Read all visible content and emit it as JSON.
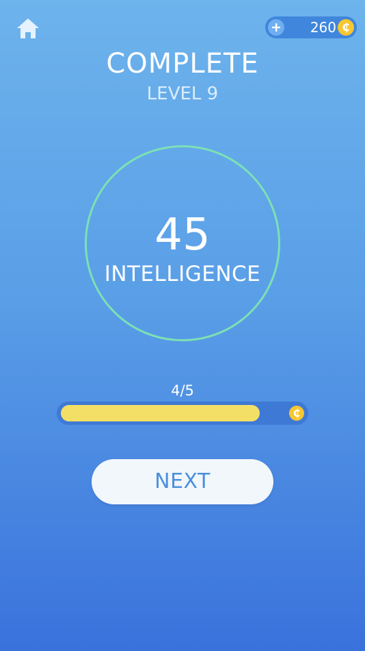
{
  "header": {
    "home_icon": "home-icon",
    "coins": {
      "plus_icon": "plus-icon",
      "count": "260",
      "coin_symbol": "₵"
    }
  },
  "result": {
    "title": "COMPLETE",
    "level_label": "LEVEL 9",
    "score": "45",
    "score_label": "INTELLIGENCE"
  },
  "progress": {
    "text": "4/5",
    "fraction": 0.8,
    "reward_symbol": "₵"
  },
  "actions": {
    "next_label": "NEXT"
  },
  "colors": {
    "background_top": "#6db3ec",
    "background_bottom": "#3a72dc",
    "ring": "#7de0b4",
    "progress_fill": "#f4df66",
    "progress_track": "#3f79d6",
    "coin": "#f7c630",
    "button_bg": "#f2f7fc",
    "button_text": "#4a8fdc"
  }
}
